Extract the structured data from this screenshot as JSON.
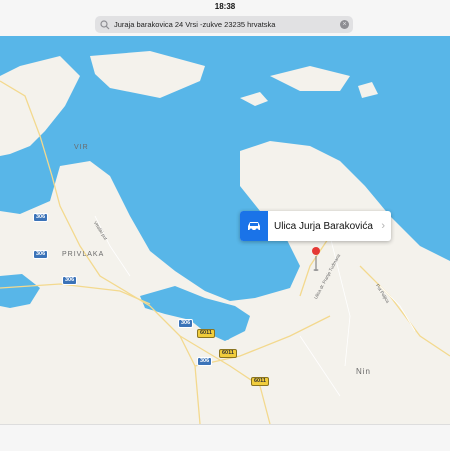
{
  "status": {
    "time": "18:38"
  },
  "search": {
    "query": "Juraja barakovica 24 Vrsi -zukve 23235 hrvatska"
  },
  "callout": {
    "title": "Ulica Jurja Barakovića"
  },
  "places": {
    "vir": "VIR",
    "privlaka": "PRIVLAKA",
    "nin": "Nin"
  },
  "roads": {
    "vrtaski_put": "Vrtaški put",
    "ulica_dr_franje": "Ulica dr. Franje Tuđmana",
    "put_poljica": "Put Poljica"
  },
  "shields": [
    "306",
    "306",
    "306",
    "306",
    "6011",
    "6011",
    "306",
    "6011"
  ],
  "colors": {
    "water": "#58b6e8",
    "land": "#f4f2ec",
    "road": "#f3d98e",
    "pin": "#e53935",
    "accent": "#1a73e8"
  }
}
